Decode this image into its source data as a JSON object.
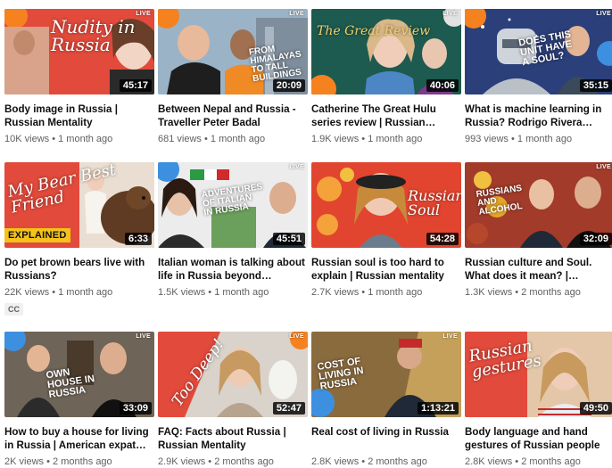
{
  "live_label": "LIVE",
  "videos": [
    {
      "title": "Body image in Russia | Russian Mentality",
      "views": "10K views",
      "age": "1 month ago",
      "duration": "45:17",
      "overlay": "Nudity in Russia"
    },
    {
      "title": "Between Nepal and Russia - Traveller Peter Badal",
      "views": "681 views",
      "age": "1 month ago",
      "duration": "20:09",
      "overlay": "From Himalayas to tall buildings"
    },
    {
      "title": "Catherine The Great Hulu series review | Russian…",
      "views": "1.9K views",
      "age": "1 month ago",
      "duration": "40:06",
      "overlay": "The Great Review"
    },
    {
      "title": "What is machine learning in Russia? Rodrigo Rivera PhD…",
      "views": "993 views",
      "age": "1 month ago",
      "duration": "35:15",
      "overlay": "Does this unit have a soul?"
    },
    {
      "title": "Do pet brown bears live with Russians?",
      "views": "22K views",
      "age": "1 month ago",
      "duration": "6:33",
      "overlay": "My Bear Best Friend",
      "tag": "EXPLAINED",
      "badge": "CC"
    },
    {
      "title": "Italian woman is talking about life in Russia beyond…",
      "views": "1.5K views",
      "age": "1 month ago",
      "duration": "45:51",
      "overlay": "Adventures of Italian in Russia"
    },
    {
      "title": "Russian soul is too hard to explain | Russian mentality",
      "views": "2.7K views",
      "age": "1 month ago",
      "duration": "54:28",
      "overlay": "Russian Soul"
    },
    {
      "title": "Russian culture and Soul. What does it mean? | Russia…",
      "views": "1.3K views",
      "age": "2 months ago",
      "duration": "32:09",
      "overlay": "Russians and alcohol"
    },
    {
      "title": "How to buy a house for living in Russia | American expat…",
      "views": "2K views",
      "age": "2 months ago",
      "duration": "33:09",
      "overlay": "Own house in Russia"
    },
    {
      "title": "FAQ: Facts about Russia | Russian Mentality",
      "views": "2.9K views",
      "age": "2 months ago",
      "duration": "52:47",
      "overlay": "Too Deep!"
    },
    {
      "title": "Real cost of living in Russia",
      "views": "2.8K views",
      "age": "2 months ago",
      "duration": "1:13:21",
      "overlay": "Cost of living in Russia"
    },
    {
      "title": "Body language and hand gestures of Russian people",
      "views": "2.8K views",
      "age": "2 months ago",
      "duration": "49:50",
      "overlay": "Russian gestures"
    }
  ],
  "meta_separator": "•",
  "colors": {
    "accent_orange": "#f5821f",
    "accent_red": "#e3342f",
    "text_primary": "#0f0f0f",
    "text_secondary": "#606060"
  }
}
